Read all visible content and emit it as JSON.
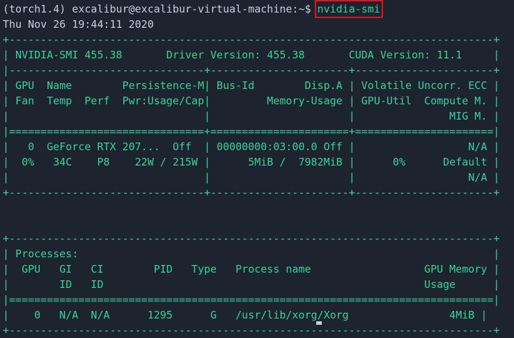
{
  "prompt": {
    "text": "(torch1.4) excalibur@excalibur-virtual-machine:~$ ",
    "command": "nvidia-smi"
  },
  "date": "Thu Nov 26 19:44:11 2020",
  "colors": {
    "background": "#1e2330",
    "output_green": "#3bd39a",
    "prompt_text": "#c9cfe0",
    "highlight_box": "#e0151d"
  },
  "output_lines": [
    "+-----------------------------------------------------------------------------+",
    "| NVIDIA-SMI 455.38       Driver Version: 455.38       CUDA Version: 11.1     |",
    "|-------------------------------+----------------------+----------------------+",
    "| GPU  Name        Persistence-M| Bus-Id        Disp.A | Volatile Uncorr. ECC |",
    "| Fan  Temp  Perf  Pwr:Usage/Cap|         Memory-Usage | GPU-Util  Compute M. |",
    "|                               |                      |               MIG M. |",
    "|===============================+======================+======================|",
    "|   0  GeForce RTX 207...  Off  | 00000000:03:00.0 Off |                  N/A |",
    "|  0%   34C    P8    22W / 215W |      5MiB /  7982MiB |      0%      Default |",
    "|                               |                      |                  N/A |",
    "+-------------------------------+----------------------+----------------------+",
    "",
    "",
    "+-----------------------------------------------------------------------------+",
    "| Processes:                                                                  |",
    "|  GPU   GI   CI        PID   Type   Process name                  GPU Memory |",
    "|        ID   ID                                                   Usage      |",
    "|=============================================================================|",
    "|    0   N/A  N/A      1295      G   /usr/lib/xorg/Xorg                4MiB |",
    "+-----------------------------------------------------------------------------+"
  ]
}
